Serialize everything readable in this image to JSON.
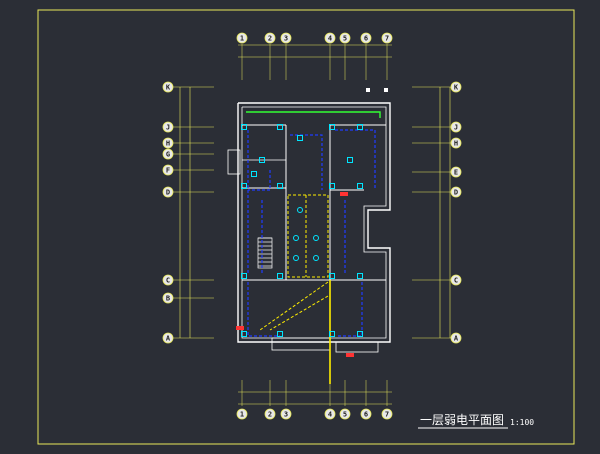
{
  "drawing": {
    "title": "一层弱电平面图",
    "scale": "1:100"
  },
  "grid_columns": [
    "1",
    "2",
    "3",
    "4",
    "5",
    "6",
    "7"
  ],
  "grid_rows_left": [
    "K",
    "J",
    "H",
    "G",
    "F",
    "D",
    "C",
    "B",
    "A"
  ],
  "grid_rows_right": [
    "K",
    "J",
    "H",
    "E",
    "D",
    "C",
    "A"
  ],
  "colors": {
    "background": "#2b2e36",
    "frame": "#e8e85a",
    "grid": "#e8e85a",
    "bubble": "#e8e8e8",
    "bubble_text": "#222222",
    "wall": "#ffffff",
    "cable": "#1f3cff",
    "device": "#00e5ff",
    "label": "#33ff33",
    "riser": "#ffee00",
    "panel": "#ff3333"
  }
}
